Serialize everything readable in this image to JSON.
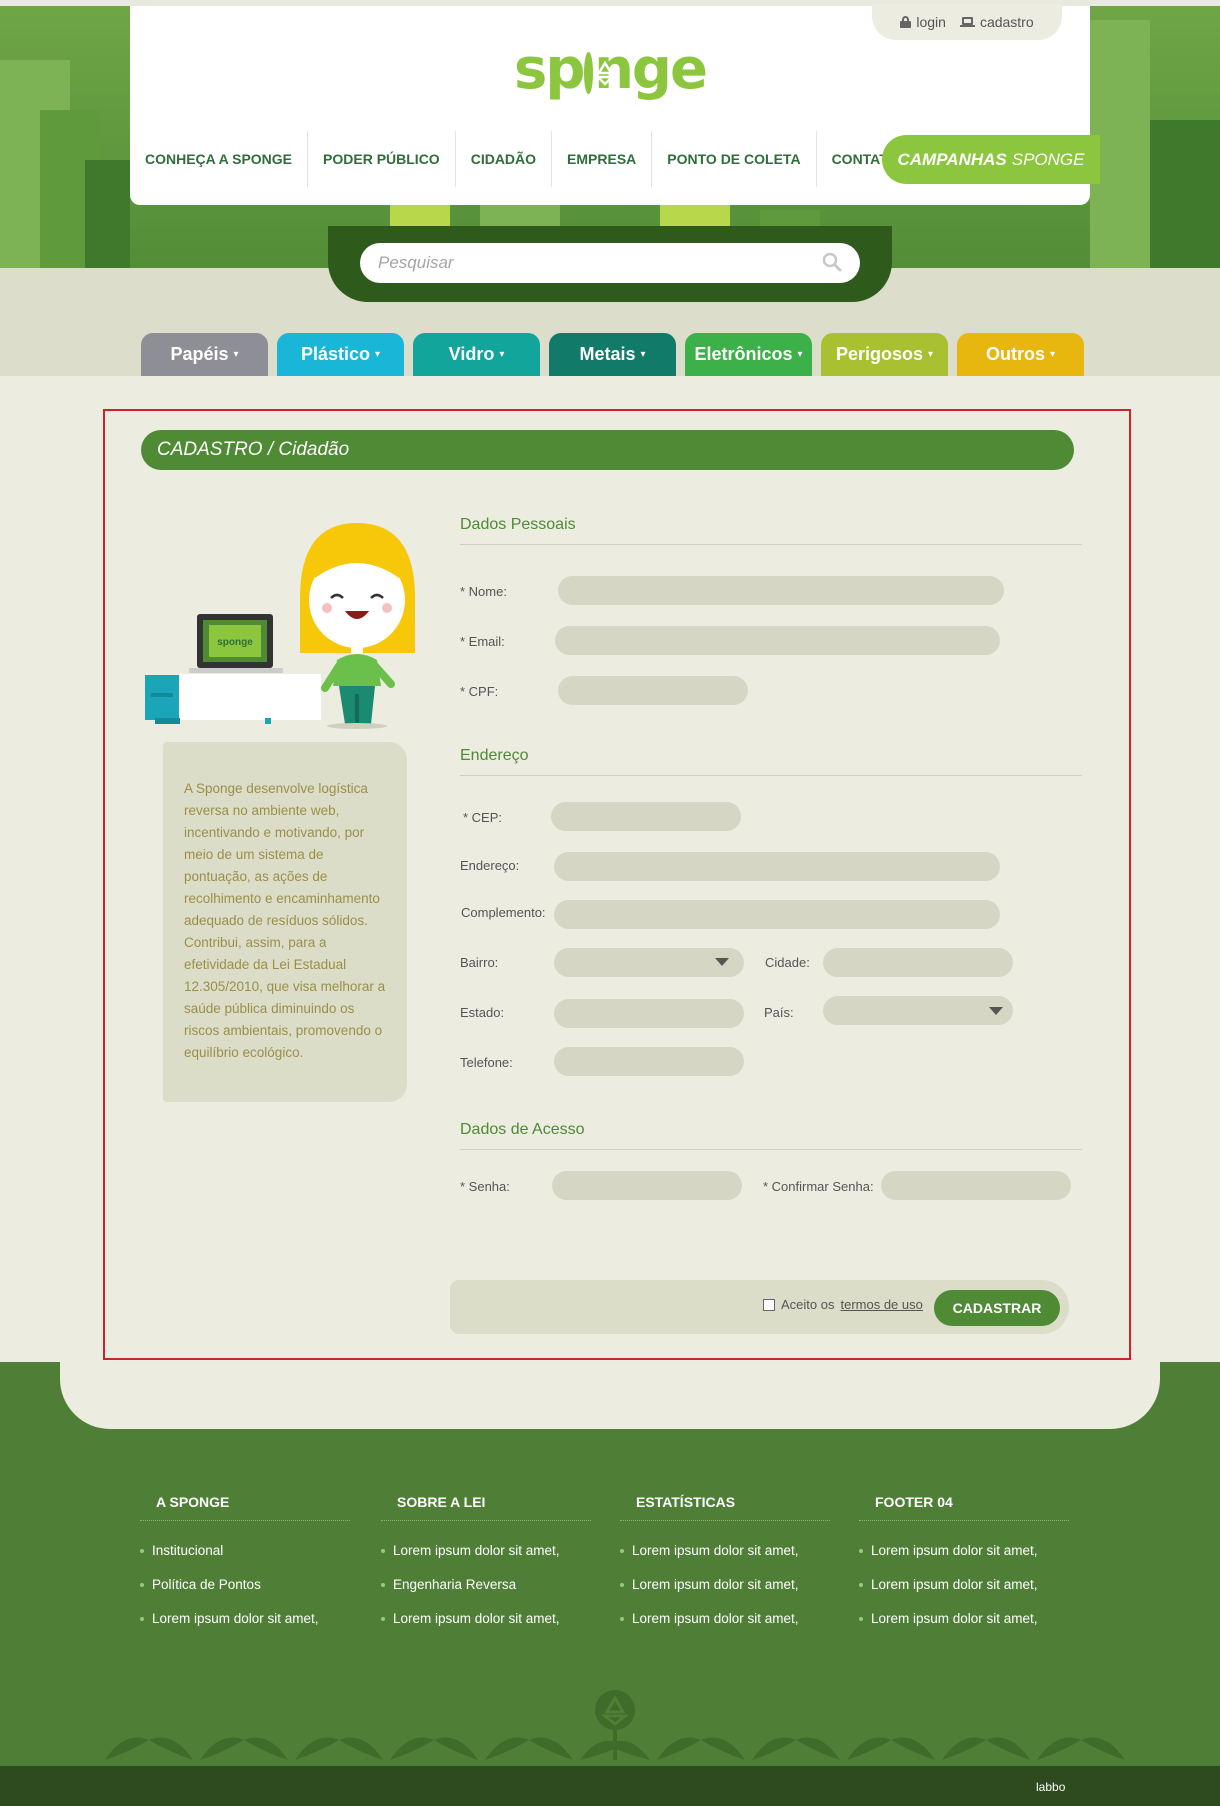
{
  "header": {
    "login": "login",
    "cadastro": "cadastro",
    "logo_left": "sp",
    "logo_right": "nge",
    "nav": [
      "CONHEÇA A SPONGE",
      "PODER PÚBLICO",
      "CIDADÃO",
      "EMPRESA",
      "PONTO DE COLETA",
      "CONTATO"
    ],
    "campaign_bold": "CAMPANHAS",
    "campaign_light": "SPONGE"
  },
  "search": {
    "placeholder": "Pesquisar"
  },
  "categories": [
    {
      "label": "Papéis",
      "color": "#8e8e96"
    },
    {
      "label": "Plástico",
      "color": "#1ab6d8"
    },
    {
      "label": "Vidro",
      "color": "#12a59c"
    },
    {
      "label": "Metais",
      "color": "#117a68"
    },
    {
      "label": "Eletrônicos",
      "color": "#3cb049"
    },
    {
      "label": "Perigosos",
      "color": "#a9c130"
    },
    {
      "label": "Outros",
      "color": "#e8b70f"
    }
  ],
  "page": {
    "title": "CADASTRO / Cidadão",
    "illus_screen": "sponge",
    "info": "A Sponge desenvolve logística reversa no ambiente web, incentivando e motivando, por meio de um sistema de pontuação, as ações de recolhimento e encaminhamento adequado de resíduos sólidos. Contribui, assim, para a efetividade da Lei Estadual 12.305/2010, que visa melhorar a saúde pública diminuindo os riscos ambientais, promovendo o equilíbrio ecológico."
  },
  "form": {
    "personal_title": "Dados Pessoais",
    "nome": "* Nome:",
    "email": "* Email:",
    "cpf": "* CPF:",
    "address_title": "Endereço",
    "cep": "* CEP:",
    "endereco": "Endereço:",
    "complemento": "Complemento:",
    "bairro": "Bairro:",
    "cidade": "Cidade:",
    "estado": "Estado:",
    "pais": "País:",
    "telefone": "Telefone:",
    "access_title": "Dados de Acesso",
    "senha": "* Senha:",
    "confirmar": "* Confirmar Senha:",
    "accept_prefix": "Aceito os",
    "accept_terms": "termos de uso",
    "submit": "CADASTRAR"
  },
  "footer": {
    "columns": [
      {
        "title": "A SPONGE",
        "items": [
          "Institucional",
          "Política de Pontos",
          "Lorem ipsum dolor sit amet,"
        ]
      },
      {
        "title": "SOBRE A LEI",
        "items": [
          "Lorem ipsum dolor sit amet,",
          "Engenharia Reversa",
          "Lorem ipsum dolor sit amet,"
        ]
      },
      {
        "title": "ESTATÍSTICAS",
        "items": [
          "Lorem ipsum dolor sit amet,",
          "Lorem ipsum dolor sit amet,",
          "Lorem ipsum dolor sit amet,"
        ]
      },
      {
        "title": "FOOTER 04",
        "items": [
          "Lorem ipsum dolor sit amet,",
          "Lorem ipsum dolor sit amet,",
          "Lorem ipsum dolor sit amet,"
        ]
      }
    ],
    "credit": "labbo"
  }
}
